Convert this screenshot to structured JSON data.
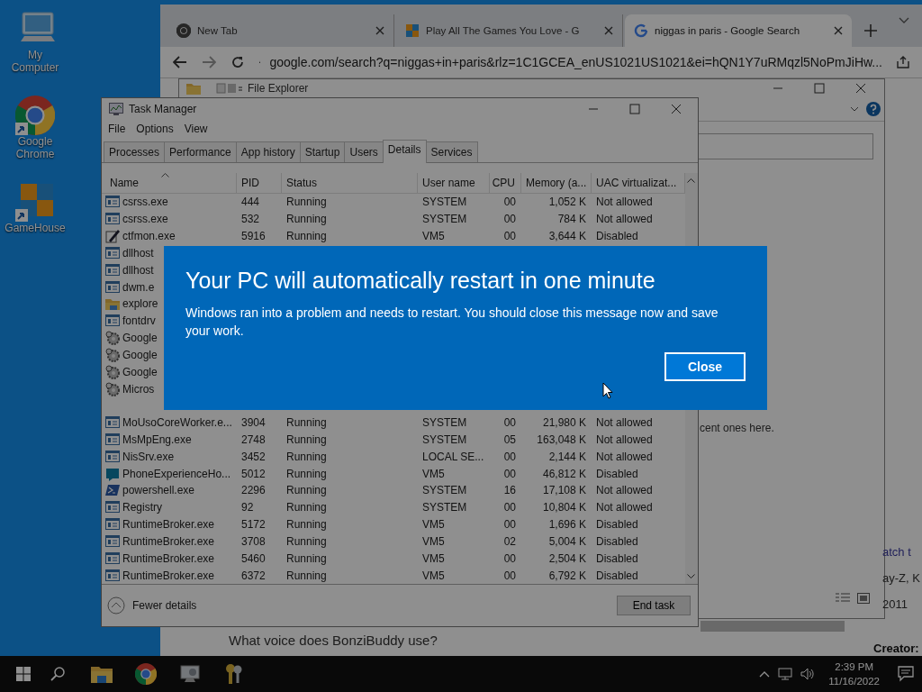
{
  "desktop_icons": [
    {
      "label": "My Computer",
      "kind": "computer"
    },
    {
      "label": "Google Chrome",
      "kind": "chrome"
    },
    {
      "label": "GameHouse",
      "kind": "gamehouse"
    }
  ],
  "browser": {
    "tabs": [
      {
        "title": "New Tab",
        "selected": false,
        "kind": "chrome"
      },
      {
        "title": "Play All The Games You Love - G",
        "selected": false,
        "kind": "game"
      },
      {
        "title": "niggas in paris - Google Search",
        "selected": true,
        "kind": "google"
      }
    ],
    "address": "google.com/search?q=niggas+in+paris&rlz=1C1GCEA_enUS1021US1021&ei=hQN1Y7uRMqzl5NoPmJiHw...",
    "explorer": {
      "title": "File Explorer",
      "message": "cent ones here."
    },
    "page_snippets": [
      {
        "text": "atch t",
        "kind": "link"
      },
      {
        "text": "ay-Z, K",
        "kind": "text"
      },
      {
        "text": "2011",
        "kind": "text"
      },
      {
        "text": "Creator:",
        "kind": "heading"
      },
      {
        "text": "What voice does BonziBuddy use?",
        "kind": "question"
      }
    ]
  },
  "task_manager": {
    "title": "Task Manager",
    "menu": [
      "File",
      "Options",
      "View"
    ],
    "tabs": [
      {
        "label": "Processes",
        "selected": false
      },
      {
        "label": "Performance",
        "selected": false
      },
      {
        "label": "App history",
        "selected": false
      },
      {
        "label": "Startup",
        "selected": false
      },
      {
        "label": "Users",
        "selected": false
      },
      {
        "label": "Details",
        "selected": true
      },
      {
        "label": "Services",
        "selected": false
      }
    ],
    "columns": [
      "Name",
      "PID",
      "Status",
      "User name",
      "CPU",
      "Memory (a...",
      "UAC virtualizat..."
    ],
    "rows": [
      {
        "kind": "exe",
        "name": "csrss.exe",
        "pid": "444",
        "status": "Running",
        "user": "SYSTEM",
        "cpu": "00",
        "memory": "1,052 K",
        "uac": "Not allowed"
      },
      {
        "kind": "exe",
        "name": "csrss.exe",
        "pid": "532",
        "status": "Running",
        "user": "SYSTEM",
        "cpu": "00",
        "memory": "784 K",
        "uac": "Not allowed"
      },
      {
        "kind": "pen",
        "name": "ctfmon.exe",
        "pid": "5916",
        "status": "Running",
        "user": "VM5",
        "cpu": "00",
        "memory": "3,644 K",
        "uac": "Disabled"
      },
      {
        "kind": "exe",
        "name": "dllhost"
      },
      {
        "kind": "exe",
        "name": "dllhost"
      },
      {
        "kind": "exe",
        "name": "dwm.e"
      },
      {
        "kind": "folder",
        "name": "explore"
      },
      {
        "kind": "exe",
        "name": "fontdrv"
      },
      {
        "kind": "service",
        "name": "Google"
      },
      {
        "kind": "service",
        "name": "Google"
      },
      {
        "kind": "service",
        "name": "Google"
      },
      {
        "kind": "service",
        "name": "Micros"
      },
      {
        "kind": "hidden"
      },
      {
        "kind": "exe",
        "name": "MoUsoCoreWorker.e...",
        "pid": "3904",
        "status": "Running",
        "user": "SYSTEM",
        "cpu": "00",
        "memory": "21,980 K",
        "uac": "Not allowed"
      },
      {
        "kind": "exe",
        "name": "MsMpEng.exe",
        "pid": "2748",
        "status": "Running",
        "user": "SYSTEM",
        "cpu": "05",
        "memory": "163,048 K",
        "uac": "Not allowed"
      },
      {
        "kind": "exe",
        "name": "NisSrv.exe",
        "pid": "3452",
        "status": "Running",
        "user": "LOCAL SE...",
        "cpu": "00",
        "memory": "2,144 K",
        "uac": "Not allowed"
      },
      {
        "kind": "phone",
        "name": "PhoneExperienceHo...",
        "pid": "5012",
        "status": "Running",
        "user": "VM5",
        "cpu": "00",
        "memory": "46,812 K",
        "uac": "Disabled"
      },
      {
        "kind": "powershell",
        "name": "powershell.exe",
        "pid": "2296",
        "status": "Running",
        "user": "SYSTEM",
        "cpu": "16",
        "memory": "17,108 K",
        "uac": "Not allowed"
      },
      {
        "kind": "exe",
        "name": "Registry",
        "pid": "92",
        "status": "Running",
        "user": "SYSTEM",
        "cpu": "00",
        "memory": "10,804 K",
        "uac": "Not allowed"
      },
      {
        "kind": "exe",
        "name": "RuntimeBroker.exe",
        "pid": "5172",
        "status": "Running",
        "user": "VM5",
        "cpu": "00",
        "memory": "1,696 K",
        "uac": "Disabled"
      },
      {
        "kind": "exe",
        "name": "RuntimeBroker.exe",
        "pid": "3708",
        "status": "Running",
        "user": "VM5",
        "cpu": "02",
        "memory": "5,004 K",
        "uac": "Disabled"
      },
      {
        "kind": "exe",
        "name": "RuntimeBroker.exe",
        "pid": "5460",
        "status": "Running",
        "user": "VM5",
        "cpu": "00",
        "memory": "2,504 K",
        "uac": "Disabled"
      },
      {
        "kind": "exe",
        "name": "RuntimeBroker.exe",
        "pid": "6372",
        "status": "Running",
        "user": "VM5",
        "cpu": "00",
        "memory": "6,792 K",
        "uac": "Disabled"
      }
    ],
    "fewer_details": "Fewer details",
    "end_task": "End task"
  },
  "dialog": {
    "title": "Your PC will automatically restart in one minute",
    "message": "Windows ran into a problem and needs to restart. You should close this message now and save your work.",
    "button": "Close"
  },
  "taskbar": {
    "time": "2:39 PM",
    "date": "11/16/2022"
  }
}
